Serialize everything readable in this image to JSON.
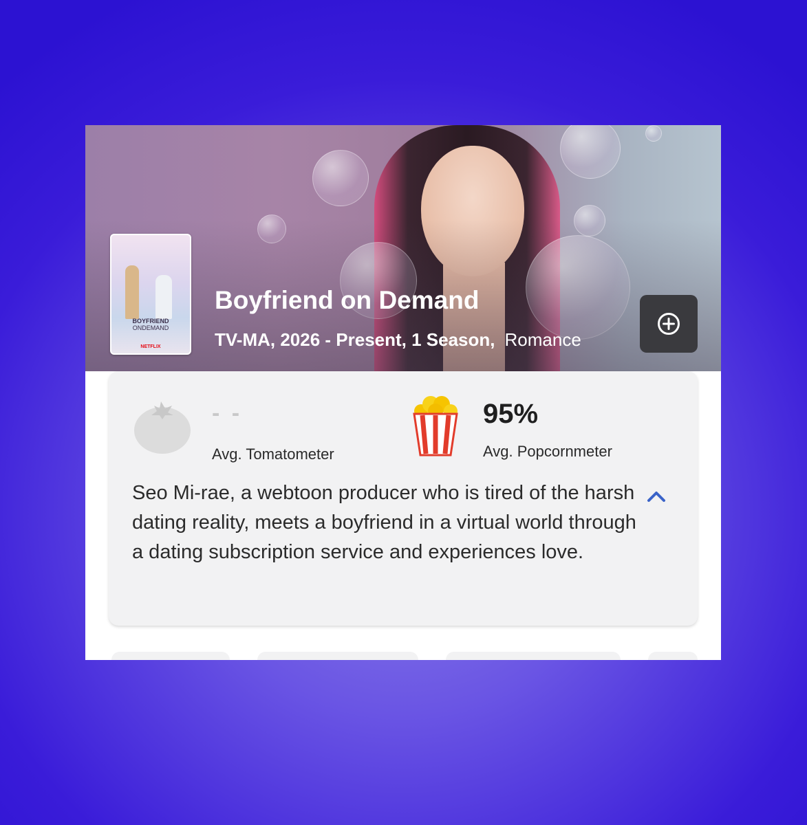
{
  "show": {
    "title": "Boyfriend on Demand",
    "meta_info": "TV-MA, 2026 - Present, 1 Season,",
    "genre": "Romance",
    "poster": {
      "title_line1": "BOYFRIEND",
      "title_line2": "ONDEMAND",
      "brand": "NETFLIX"
    }
  },
  "actions": {
    "add_icon": "plus-circle-icon"
  },
  "scores": {
    "tomatometer": {
      "value": "- -",
      "label": "Avg. Tomatometer",
      "icon": "tomato-icon"
    },
    "popcornmeter": {
      "value": "95%",
      "label": "Avg. Popcornmeter",
      "icon": "popcorn-icon"
    }
  },
  "synopsis": {
    "text": "Seo Mi-rae, a webtoon producer who is tired of the harsh dating reality, meets a boyfriend in a virtual world through a dating subscription service and experiences love.",
    "toggle_icon": "chevron-up-icon",
    "accent_color": "#3a63c8"
  },
  "colors": {
    "background_accent": "#3a1cd9",
    "popcorn_red": "#e23c2b",
    "popcorn_yellow": "#f6c400"
  }
}
